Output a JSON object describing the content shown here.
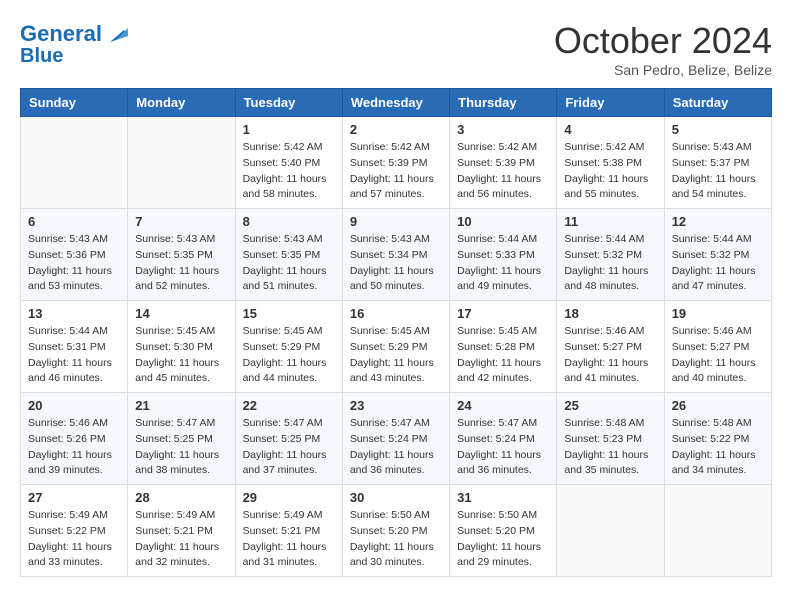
{
  "header": {
    "logo_line1": "General",
    "logo_line2": "Blue",
    "month": "October 2024",
    "location": "San Pedro, Belize, Belize"
  },
  "days_of_week": [
    "Sunday",
    "Monday",
    "Tuesday",
    "Wednesday",
    "Thursday",
    "Friday",
    "Saturday"
  ],
  "weeks": [
    [
      {
        "day": "",
        "info": ""
      },
      {
        "day": "",
        "info": ""
      },
      {
        "day": "1",
        "info": "Sunrise: 5:42 AM\nSunset: 5:40 PM\nDaylight: 11 hours and 58 minutes."
      },
      {
        "day": "2",
        "info": "Sunrise: 5:42 AM\nSunset: 5:39 PM\nDaylight: 11 hours and 57 minutes."
      },
      {
        "day": "3",
        "info": "Sunrise: 5:42 AM\nSunset: 5:39 PM\nDaylight: 11 hours and 56 minutes."
      },
      {
        "day": "4",
        "info": "Sunrise: 5:42 AM\nSunset: 5:38 PM\nDaylight: 11 hours and 55 minutes."
      },
      {
        "day": "5",
        "info": "Sunrise: 5:43 AM\nSunset: 5:37 PM\nDaylight: 11 hours and 54 minutes."
      }
    ],
    [
      {
        "day": "6",
        "info": "Sunrise: 5:43 AM\nSunset: 5:36 PM\nDaylight: 11 hours and 53 minutes."
      },
      {
        "day": "7",
        "info": "Sunrise: 5:43 AM\nSunset: 5:35 PM\nDaylight: 11 hours and 52 minutes."
      },
      {
        "day": "8",
        "info": "Sunrise: 5:43 AM\nSunset: 5:35 PM\nDaylight: 11 hours and 51 minutes."
      },
      {
        "day": "9",
        "info": "Sunrise: 5:43 AM\nSunset: 5:34 PM\nDaylight: 11 hours and 50 minutes."
      },
      {
        "day": "10",
        "info": "Sunrise: 5:44 AM\nSunset: 5:33 PM\nDaylight: 11 hours and 49 minutes."
      },
      {
        "day": "11",
        "info": "Sunrise: 5:44 AM\nSunset: 5:32 PM\nDaylight: 11 hours and 48 minutes."
      },
      {
        "day": "12",
        "info": "Sunrise: 5:44 AM\nSunset: 5:32 PM\nDaylight: 11 hours and 47 minutes."
      }
    ],
    [
      {
        "day": "13",
        "info": "Sunrise: 5:44 AM\nSunset: 5:31 PM\nDaylight: 11 hours and 46 minutes."
      },
      {
        "day": "14",
        "info": "Sunrise: 5:45 AM\nSunset: 5:30 PM\nDaylight: 11 hours and 45 minutes."
      },
      {
        "day": "15",
        "info": "Sunrise: 5:45 AM\nSunset: 5:29 PM\nDaylight: 11 hours and 44 minutes."
      },
      {
        "day": "16",
        "info": "Sunrise: 5:45 AM\nSunset: 5:29 PM\nDaylight: 11 hours and 43 minutes."
      },
      {
        "day": "17",
        "info": "Sunrise: 5:45 AM\nSunset: 5:28 PM\nDaylight: 11 hours and 42 minutes."
      },
      {
        "day": "18",
        "info": "Sunrise: 5:46 AM\nSunset: 5:27 PM\nDaylight: 11 hours and 41 minutes."
      },
      {
        "day": "19",
        "info": "Sunrise: 5:46 AM\nSunset: 5:27 PM\nDaylight: 11 hours and 40 minutes."
      }
    ],
    [
      {
        "day": "20",
        "info": "Sunrise: 5:46 AM\nSunset: 5:26 PM\nDaylight: 11 hours and 39 minutes."
      },
      {
        "day": "21",
        "info": "Sunrise: 5:47 AM\nSunset: 5:25 PM\nDaylight: 11 hours and 38 minutes."
      },
      {
        "day": "22",
        "info": "Sunrise: 5:47 AM\nSunset: 5:25 PM\nDaylight: 11 hours and 37 minutes."
      },
      {
        "day": "23",
        "info": "Sunrise: 5:47 AM\nSunset: 5:24 PM\nDaylight: 11 hours and 36 minutes."
      },
      {
        "day": "24",
        "info": "Sunrise: 5:47 AM\nSunset: 5:24 PM\nDaylight: 11 hours and 36 minutes."
      },
      {
        "day": "25",
        "info": "Sunrise: 5:48 AM\nSunset: 5:23 PM\nDaylight: 11 hours and 35 minutes."
      },
      {
        "day": "26",
        "info": "Sunrise: 5:48 AM\nSunset: 5:22 PM\nDaylight: 11 hours and 34 minutes."
      }
    ],
    [
      {
        "day": "27",
        "info": "Sunrise: 5:49 AM\nSunset: 5:22 PM\nDaylight: 11 hours and 33 minutes."
      },
      {
        "day": "28",
        "info": "Sunrise: 5:49 AM\nSunset: 5:21 PM\nDaylight: 11 hours and 32 minutes."
      },
      {
        "day": "29",
        "info": "Sunrise: 5:49 AM\nSunset: 5:21 PM\nDaylight: 11 hours and 31 minutes."
      },
      {
        "day": "30",
        "info": "Sunrise: 5:50 AM\nSunset: 5:20 PM\nDaylight: 11 hours and 30 minutes."
      },
      {
        "day": "31",
        "info": "Sunrise: 5:50 AM\nSunset: 5:20 PM\nDaylight: 11 hours and 29 minutes."
      },
      {
        "day": "",
        "info": ""
      },
      {
        "day": "",
        "info": ""
      }
    ]
  ]
}
